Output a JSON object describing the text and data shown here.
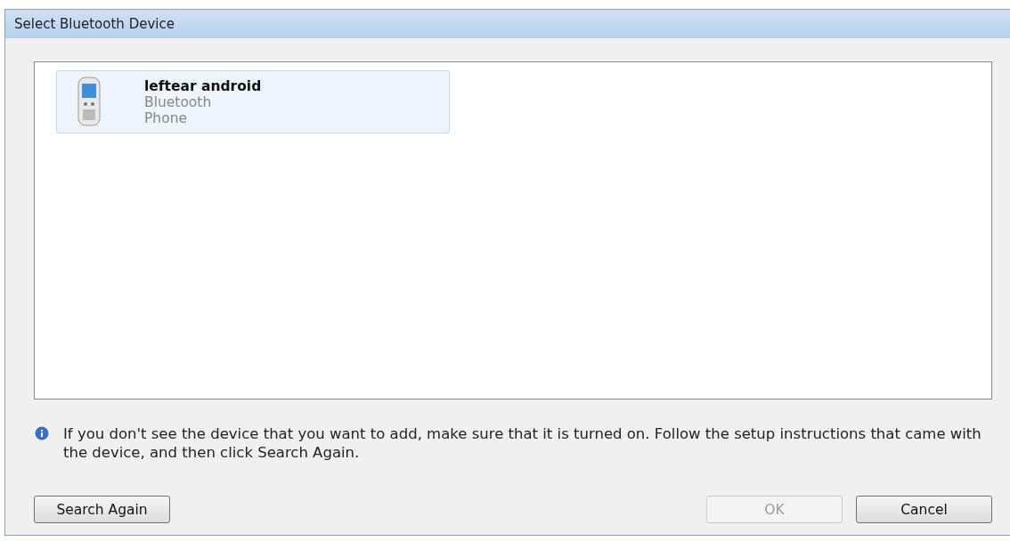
{
  "window": {
    "title": "Select Bluetooth Device"
  },
  "devices": [
    {
      "name": "leftear android",
      "details": [
        "Bluetooth",
        "Phone"
      ],
      "selected": true
    }
  ],
  "info": "If you don't see the device that you want to add, make sure that it is turned on. Follow the setup instructions that came with the device, and then click Search Again.",
  "buttons_left": [
    {
      "label": "Search Again",
      "disabled": false
    }
  ],
  "buttons_right": [
    {
      "label": "OK",
      "disabled": true
    },
    {
      "label": "Cancel",
      "disabled": false
    }
  ]
}
